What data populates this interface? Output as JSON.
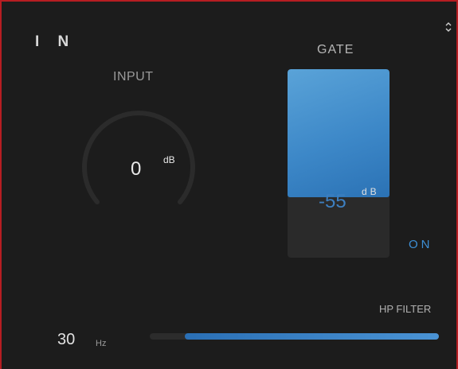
{
  "section": {
    "title": "I N",
    "expand_icon": "chevron-up-down-icon"
  },
  "input": {
    "label": "INPUT",
    "value": "0",
    "unit": "dB",
    "knob_level": 0.5
  },
  "gate": {
    "label": "GATE",
    "value": "-55",
    "unit": "dB",
    "toggle": "ON",
    "level": 0.68,
    "accent": "#3d88c8"
  },
  "hp_filter": {
    "label": "HP FILTER",
    "value": "30",
    "unit": "Hz",
    "range_start": 0.12,
    "range_end": 1.0,
    "accent": "#2f7fc8"
  },
  "colors": {
    "background": "#1c1c1c",
    "border": "#b61d22"
  }
}
